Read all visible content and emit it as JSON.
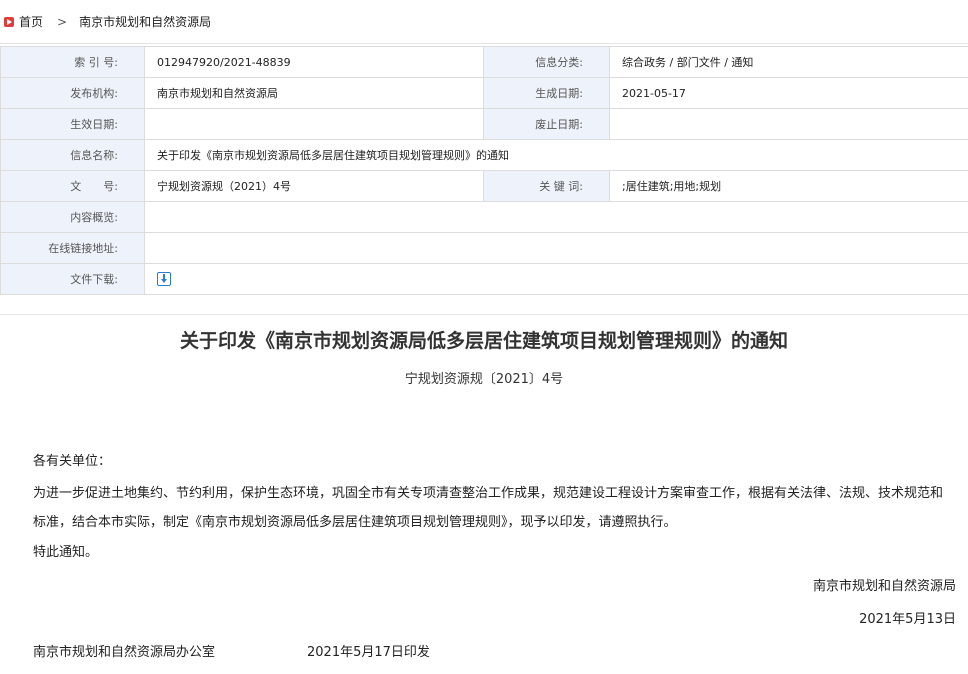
{
  "breadcrumb": {
    "home": "首页",
    "separator": ">",
    "current": "南京市规划和自然资源局"
  },
  "meta": {
    "index_label": "索 引 号:",
    "index_value": "012947920/2021-48839",
    "category_label": "信息分类:",
    "category_value": "综合政务 / 部门文件 / 通知",
    "issuer_label": "发布机构:",
    "issuer_value": "南京市规划和自然资源局",
    "created_label": "生成日期:",
    "created_value": "2021-05-17",
    "effective_label": "生效日期:",
    "effective_value": "",
    "abolished_label": "废止日期:",
    "abolished_value": "",
    "name_label": "信息名称:",
    "name_value": "关于印发《南京市规划资源局低多层居住建筑项目规划管理规则》的通知",
    "docno_label": "文　　号:",
    "docno_value": "宁规划资源规（2021）4号",
    "keywords_label": "关 键 词:",
    "keywords_value": ";居住建筑;用地;规划",
    "summary_label": "内容概览:",
    "summary_value": "",
    "link_label": "在线链接地址:",
    "link_value": "",
    "download_label": "文件下载:"
  },
  "doc": {
    "title": "关于印发《南京市规划资源局低多层居住建筑项目规划管理规则》的通知",
    "number": "宁规划资源规〔2021〕4号",
    "salutation": "各有关单位：",
    "paragraph": "为进一步促进土地集约、节约利用，保护生态环境，巩固全市有关专项清查整治工作成果，规范建设工程设计方案审查工作，根据有关法律、法规、技术规范和标准，结合本市实际，制定《南京市规划资源局低多层居住建筑项目规划管理规则》，现予以印发，请遵照执行。",
    "closing": "特此通知。",
    "sign_org": "南京市规划和自然资源局",
    "sign_date": "2021年5月13日",
    "footer_office": "南京市规划和自然资源局办公室",
    "footer_date": "2021年5月17日印发"
  },
  "icons": {
    "home": "home-icon",
    "download": "download-icon"
  },
  "colors": {
    "label_bg": "#eef3fb",
    "accent": "#2b7cd3",
    "home_icon": "#e03c3c"
  }
}
